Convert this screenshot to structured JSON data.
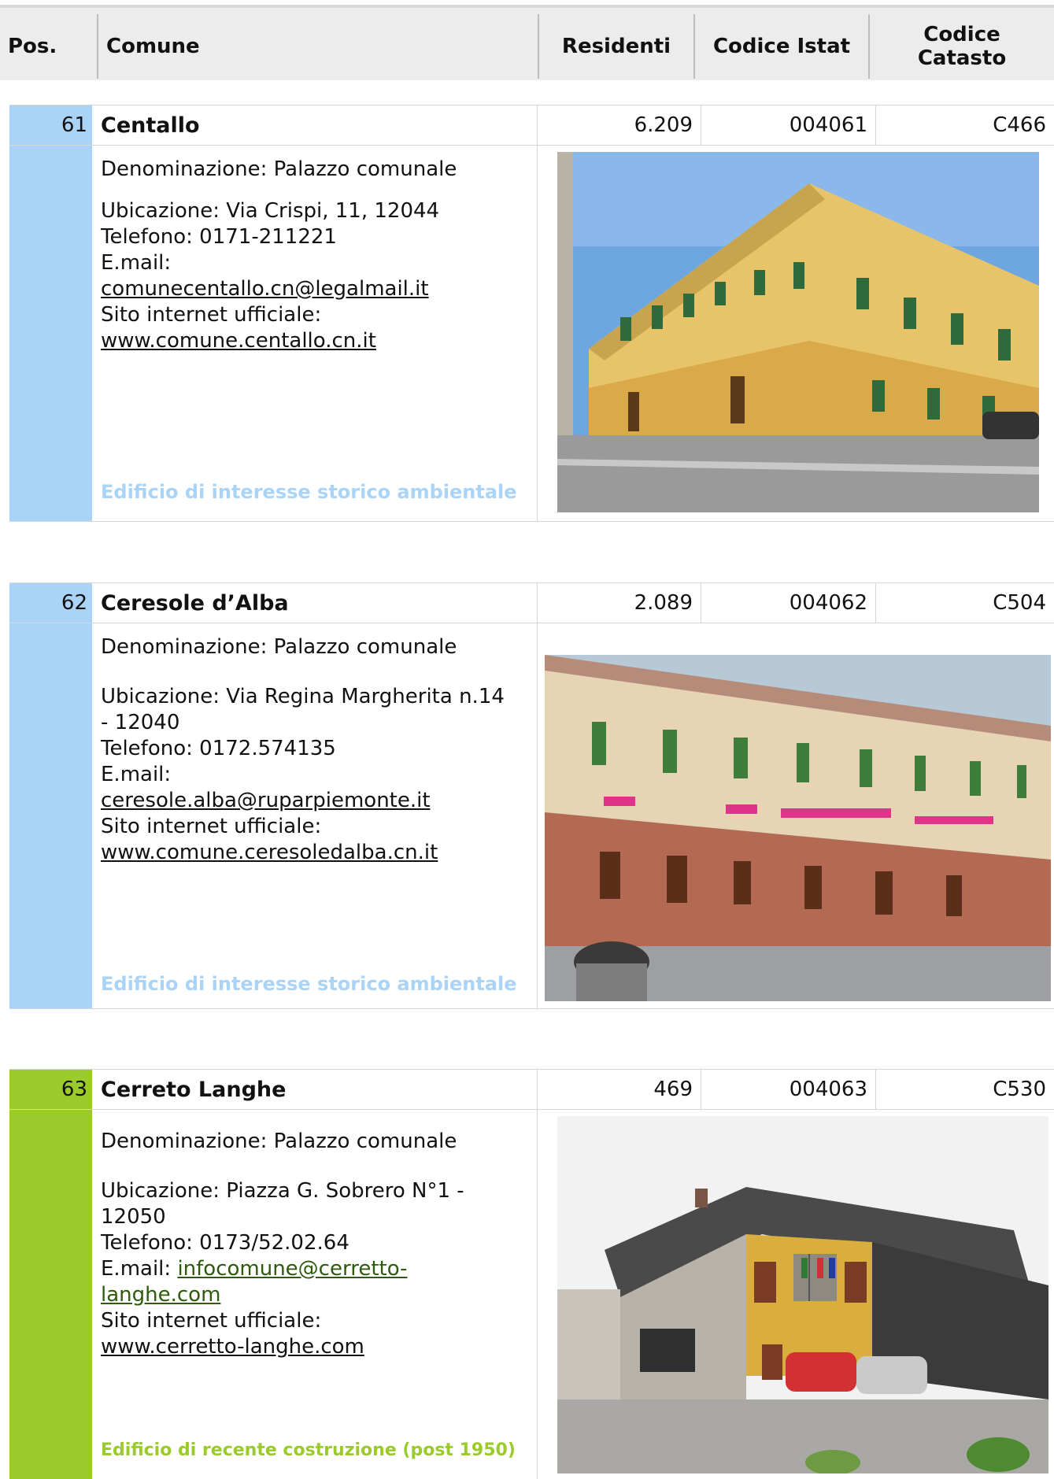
{
  "header": {
    "pos": "Pos.",
    "comune": "Comune",
    "residenti": "Residenti",
    "codice_istat": "Codice Istat",
    "codice_catasto_line1": "Codice",
    "codice_catasto_line2": "Catasto"
  },
  "labels": {
    "denominazione": "Denominazione:",
    "ubicazione": "Ubicazione:",
    "telefono": "Telefono:",
    "email": "E.mail:",
    "sito": "Sito internet ufficiale:"
  },
  "colors": {
    "blue_category": "#a9d4f7",
    "green_category": "#9acb2b"
  },
  "entries": [
    {
      "pos": "61",
      "name": "Centallo",
      "residenti": "6.209",
      "istat": "004061",
      "catasto": "C466",
      "denominazione": "Denominazione: Palazzo comunale",
      "ubicazione": "Ubicazione: Via Crispi, 11, 12044",
      "telefono": "Telefono: 0171-211221",
      "email_label": "E.mail:",
      "email": "comunecentallo.cn@legalmail.it",
      "sito_label": "Sito internet ufficiale:",
      "sito": "www.comune.centallo.cn.it",
      "category": "Edificio di interesse storico ambientale",
      "photo_icon": "town-hall-photo"
    },
    {
      "pos": "62",
      "name": "Ceresole d’Alba",
      "residenti": "2.089",
      "istat": "004062",
      "catasto": "C504",
      "denominazione": "Denominazione: Palazzo comunale",
      "ubicazione_1": "Ubicazione: Via Regina Margherita n.14",
      "ubicazione_2": "- 12040",
      "telefono": "Telefono: 0172.574135",
      "email_label": "E.mail:",
      "email": "ceresole.alba@ruparpiemonte.it",
      "sito_label": "Sito internet ufficiale:",
      "sito": "www.comune.ceresoledalba.cn.it",
      "category": "Edificio di interesse storico ambientale",
      "photo_icon": "town-hall-photo"
    },
    {
      "pos": "63",
      "name": "Cerreto Langhe",
      "residenti": "469",
      "istat": "004063",
      "catasto": "C530",
      "denominazione": "Denominazione: Palazzo comunale",
      "ubicazione_1": "Ubicazione: Piazza G. Sobrero N°1 -",
      "ubicazione_2": "12050",
      "telefono": "Telefono: 0173/52.02.64",
      "email_label": "E.mail:",
      "email_1": "infocomune@cerretto-",
      "email_2": "langhe.com",
      "sito_label": "Sito internet ufficiale:",
      "sito": "www.cerretto-langhe.com",
      "category": "Edificio di recente costruzione (post 1950)",
      "photo_icon": "town-hall-photo"
    }
  ]
}
